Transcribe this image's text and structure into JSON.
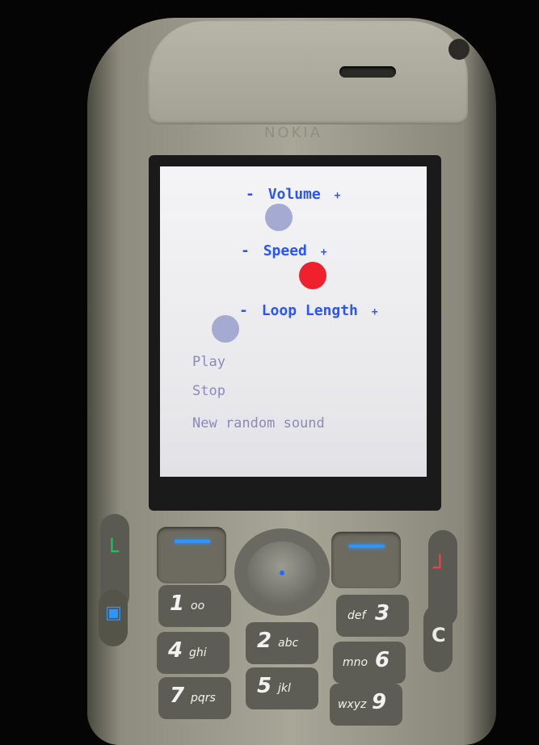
{
  "phone": {
    "brand": "NOKIA"
  },
  "screen": {
    "controls": [
      {
        "label": "Volume",
        "minus": "-",
        "plus": "+",
        "knob_color": "#a4aad2"
      },
      {
        "label": "Speed",
        "minus": "-",
        "plus": "+",
        "knob_color": "#f0202c"
      },
      {
        "label": "Loop Length",
        "minus": "-",
        "plus": "+",
        "knob_color": "#a4aad2"
      }
    ],
    "menu": [
      {
        "label": "Play"
      },
      {
        "label": "Stop"
      },
      {
        "label": "New random sound"
      }
    ],
    "label_color": "#2a54ff",
    "menu_color": "#8a8ab8"
  },
  "keypad": {
    "call_icon": "call-icon",
    "end_icon": "end-call-icon",
    "keys": [
      {
        "num": "1",
        "letters": "oo"
      },
      {
        "num": "2",
        "letters": "abc"
      },
      {
        "num": "3",
        "letters": "def"
      },
      {
        "num": "4",
        "letters": "ghi"
      },
      {
        "num": "5",
        "letters": "jkl"
      },
      {
        "num": "6",
        "letters": "mno"
      },
      {
        "num": "7",
        "letters": "pqrs"
      },
      {
        "num": "9",
        "letters": "wxyz"
      }
    ],
    "c_key": "C"
  }
}
